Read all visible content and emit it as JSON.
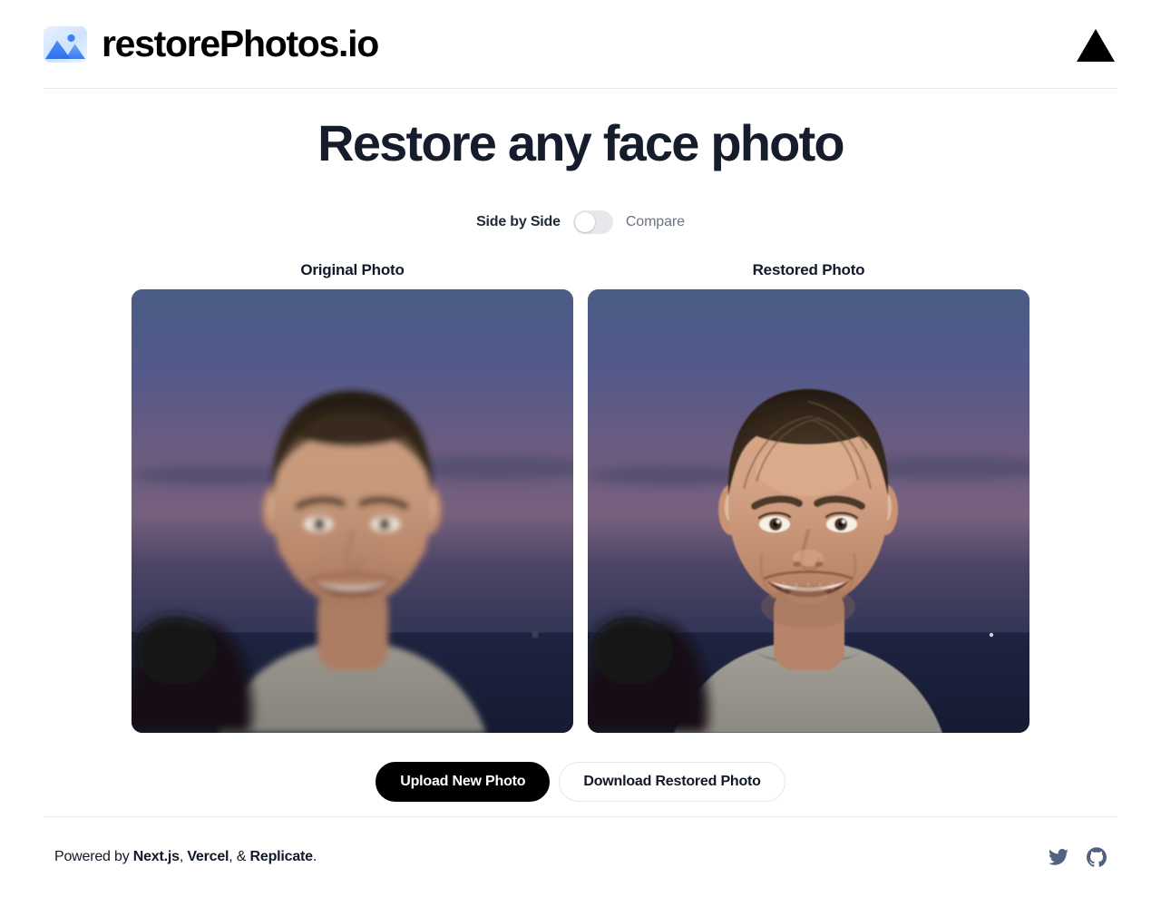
{
  "header": {
    "brand_name": "restorePhotos.io",
    "logo_icon": "photo-mountain-icon",
    "vercel_icon": "vercel-triangle-icon"
  },
  "main": {
    "headline": "Restore any face photo",
    "toggle": {
      "left_label": "Side by Side",
      "right_label": "Compare",
      "state": "off"
    },
    "panels": [
      {
        "caption": "Original Photo",
        "alt": "blurry-portrait-of-smiling-man-at-dusk-by-the-sea"
      },
      {
        "caption": "Restored Photo",
        "alt": "sharpened-portrait-of-smiling-man-at-dusk-by-the-sea"
      }
    ],
    "actions": {
      "primary_label": "Upload New Photo",
      "secondary_label": "Download Restored Photo"
    }
  },
  "footer": {
    "prefix": "Powered by ",
    "brand_1": "Next.js",
    "sep_1": ", ",
    "brand_2": "Vercel",
    "sep_2": ", & ",
    "brand_3": "Replicate",
    "suffix": ".",
    "social": [
      {
        "name": "twitter-icon"
      },
      {
        "name": "github-icon"
      }
    ]
  },
  "colors": {
    "accent_black": "#000000",
    "headline": "#151c2c",
    "muted_text": "#6b7280",
    "divider": "#e8eaed",
    "social": "#526180",
    "logo_blue": "#3b82f6"
  }
}
